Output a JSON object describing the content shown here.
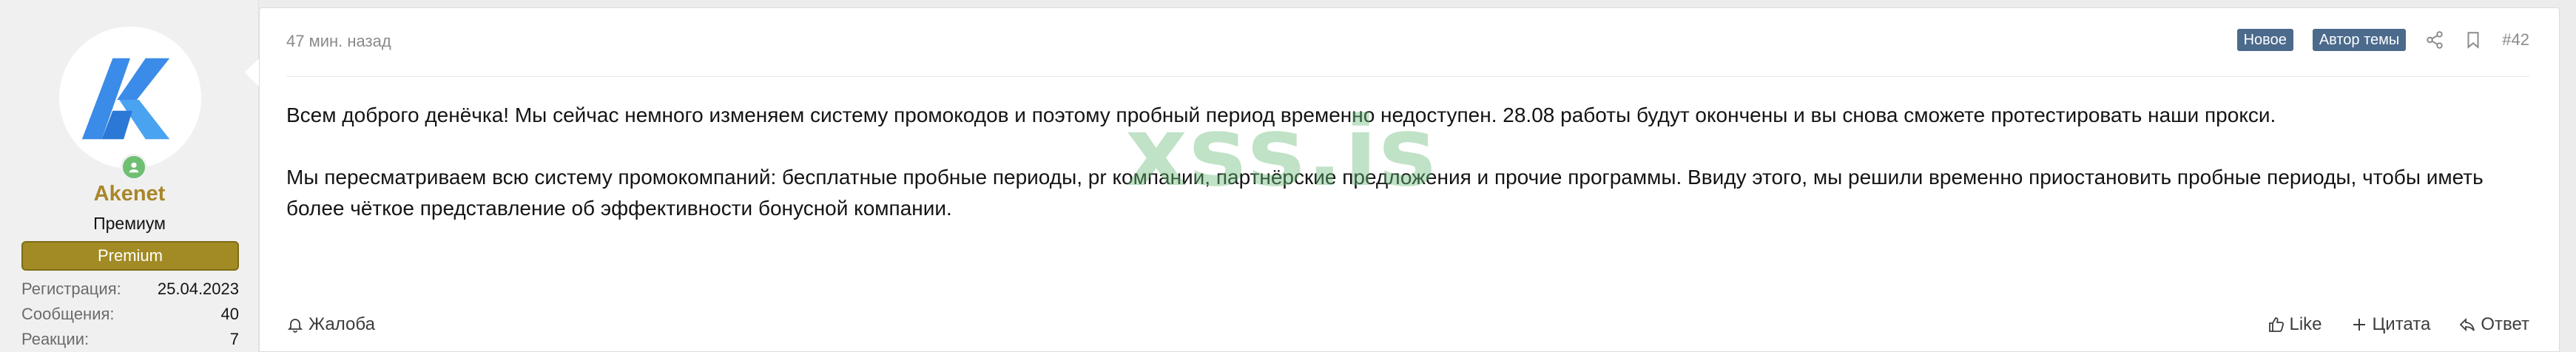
{
  "user": {
    "name": "Akenet",
    "title": "Премиум",
    "banner": "Premium",
    "avatar_icon": "akenet-logo",
    "status_icon": "online-user-icon",
    "stats": [
      {
        "label": "Регистрация:",
        "value": "25.04.2023"
      },
      {
        "label": "Сообщения:",
        "value": "40"
      },
      {
        "label": "Реакции:",
        "value": "7"
      }
    ]
  },
  "post": {
    "time": "47 мин. назад",
    "badges": [
      "Новое",
      "Автор темы"
    ],
    "number": "#42",
    "paragraphs": [
      "Всем доброго денёчка! Мы сейчас немного изменяем систему промокодов и поэтому пробный период временно недоступен. 28.08 работы будут окончены и вы снова сможете протестировать наши прокси.",
      "Мы пересматриваем всю систему промокомпаний: бесплатные пробные периоды, pr компании, партнёрские предложения и прочие программы. Ввиду этого, мы решили временно приостановить пробные периоды, чтобы иметь более чёткое представление об эффективности бонусной компании."
    ],
    "watermark": "xss.is"
  },
  "footer": {
    "report_label": "Жалоба",
    "like_label": "Like",
    "quote_label": "Цитата",
    "reply_label": "Ответ"
  },
  "colors": {
    "username": "#a8862a",
    "banner": "#a28b24",
    "badge": "#4b6a8c",
    "watermark": "#69ba76"
  }
}
